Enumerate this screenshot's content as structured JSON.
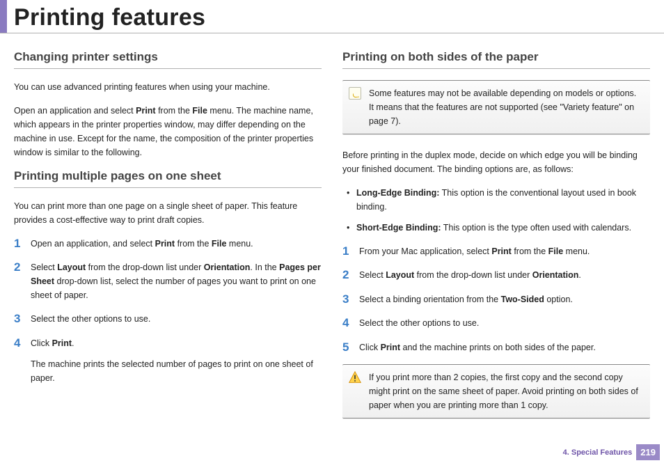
{
  "header": {
    "title": "Printing features"
  },
  "left": {
    "h1": "Changing printer settings",
    "p1": "You can use advanced printing features when using your machine.",
    "p2_pre": "Open an application and select ",
    "p2_b1": "Print",
    "p2_mid1": " from the ",
    "p2_b2": "File",
    "p2_post": " menu. The machine name, which appears in the printer properties window, may differ depending on the machine in use. Except for the name, the composition of the printer properties window is similar to the following.",
    "h2": "Printing multiple pages on one sheet",
    "p3": "You can print more than one page on a single sheet of paper. This feature provides a cost-effective way to print draft copies.",
    "steps": {
      "s1_pre": "Open an application, and select ",
      "s1_b1": "Print",
      "s1_mid": " from the ",
      "s1_b2": "File",
      "s1_post": " menu.",
      "s2_pre": "Select ",
      "s2_b1": "Layout",
      "s2_mid1": " from the drop-down list under ",
      "s2_b2": "Orientation",
      "s2_mid2": ". In the ",
      "s2_b3": "Pages per Sheet",
      "s2_post": " drop-down list, select the number of pages you want to print on one sheet of paper.",
      "s3": "Select the other options to use.",
      "s4_pre": "Click ",
      "s4_b1": "Print",
      "s4_post": ".",
      "s4_sub": "The machine prints the selected number of pages to print on one sheet of paper."
    }
  },
  "right": {
    "h1": "Printing on both sides of the paper",
    "note": "Some features may not be available depending on models or options. It means that the features are not supported (see \"Variety feature\" on page 7).",
    "p1": "Before printing in the duplex mode, decide on which edge you will be binding your finished document. The binding options are, as follows:",
    "bul1_b": "Long-Edge Binding:",
    "bul1_t": " This option is the conventional layout used in book binding.",
    "bul2_b": "Short-Edge Binding:",
    "bul2_t": " This option is the type often used with calendars.",
    "steps": {
      "s1_pre": "From your Mac application, select ",
      "s1_b1": "Print",
      "s1_mid": " from the ",
      "s1_b2": "File",
      "s1_post": " menu.",
      "s2_pre": "Select ",
      "s2_b1": "Layout",
      "s2_mid": " from the drop-down list under ",
      "s2_b2": "Orientation",
      "s2_post": ".",
      "s3_pre": "Select a binding orientation from the ",
      "s3_b1": "Two-Sided",
      "s3_post": " option.",
      "s4": "Select the other options to use.",
      "s5_pre": "Click ",
      "s5_b1": "Print",
      "s5_post": " and the machine prints on both sides of the paper."
    },
    "warn": "If you print more than 2 copies, the first copy and the second copy might print on the same sheet of paper. Avoid printing on both sides of paper when you are printing more than 1 copy."
  },
  "footer": {
    "chapter": "4.  Special Features",
    "page": "219"
  }
}
